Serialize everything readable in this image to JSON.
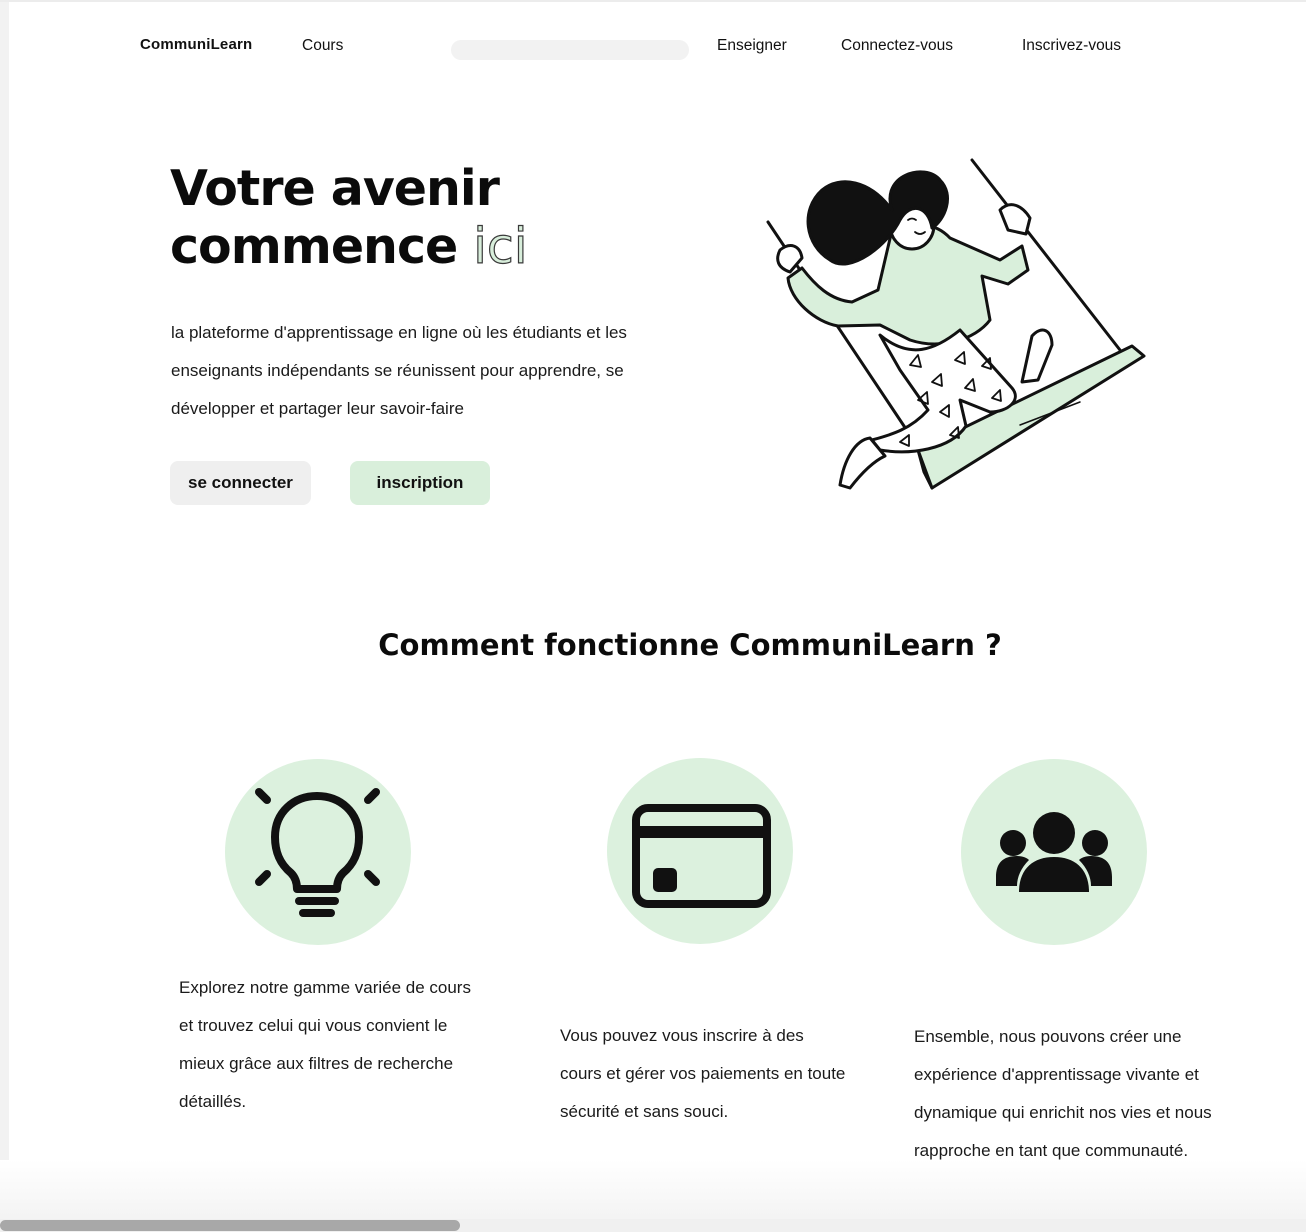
{
  "nav": {
    "brand": "CommuniLearn",
    "courses": "Cours",
    "search_placeholder": "",
    "teach": "Enseigner",
    "login": "Connectez-vous",
    "signup": "Inscrivez-vous"
  },
  "hero": {
    "title_line1": "Votre avenir",
    "title_line2_main": "commence",
    "title_line2_accent": "ici",
    "description": "la plateforme d'apprentissage en ligne où les étudiants et les enseignants indépendants se réunissent pour apprendre, se développer et partager leur savoir-faire",
    "login_button": "se connecter",
    "signup_button": "inscription",
    "illustration": "woman-on-swing-illustration"
  },
  "section": {
    "title": "Comment fonctionne CommuniLearn ?"
  },
  "features": [
    {
      "icon": "lightbulb-icon",
      "text": "Explorez notre gamme variée de cours et trouvez celui qui vous convient le mieux grâce aux filtres de recherche détaillés."
    },
    {
      "icon": "credit-card-icon",
      "text": "Vous pouvez vous inscrire à des cours et gérer vos paiements en toute sécurité et sans souci."
    },
    {
      "icon": "users-group-icon",
      "text": "Ensemble, nous pouvons créer une expérience d'apprentissage vivante et dynamique qui enrichit nos vies et nous rapproche en tant que communauté."
    }
  ],
  "colors": {
    "accent_green": "#dcf1de",
    "button_grey": "#efefef",
    "text": "#111111"
  }
}
